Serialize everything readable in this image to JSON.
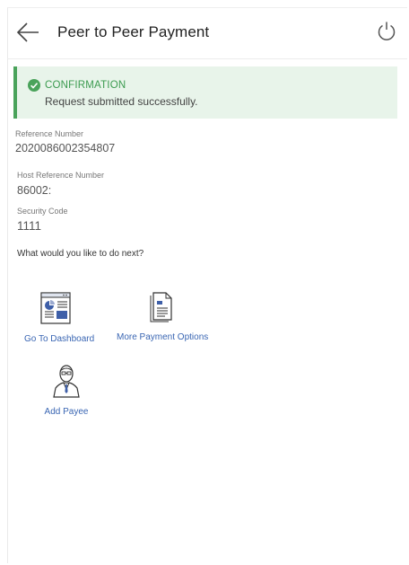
{
  "header": {
    "title": "Peer to Peer Payment",
    "back_icon": "arrow-left-icon",
    "logout_icon": "power-icon"
  },
  "confirmation": {
    "title": "CONFIRMATION",
    "message": "Request submitted successfully.",
    "icon": "check-circle-icon",
    "accent_color": "#4aa35b",
    "background_color": "#e8f4ea"
  },
  "details": {
    "reference_number": {
      "label": "Reference Number",
      "value": "2020086002354807"
    },
    "host_reference_number": {
      "label": "Host Reference Number",
      "value": "86002:"
    },
    "security_code": {
      "label": "Security Code",
      "value": "1111"
    }
  },
  "next_steps": {
    "prompt": "What would you like to do next?",
    "actions": [
      {
        "label": "Go To Dashboard",
        "icon": "dashboard-icon"
      },
      {
        "label": "More Payment Options",
        "icon": "document-icon"
      },
      {
        "label": "Add Payee",
        "icon": "user-icon"
      }
    ]
  }
}
